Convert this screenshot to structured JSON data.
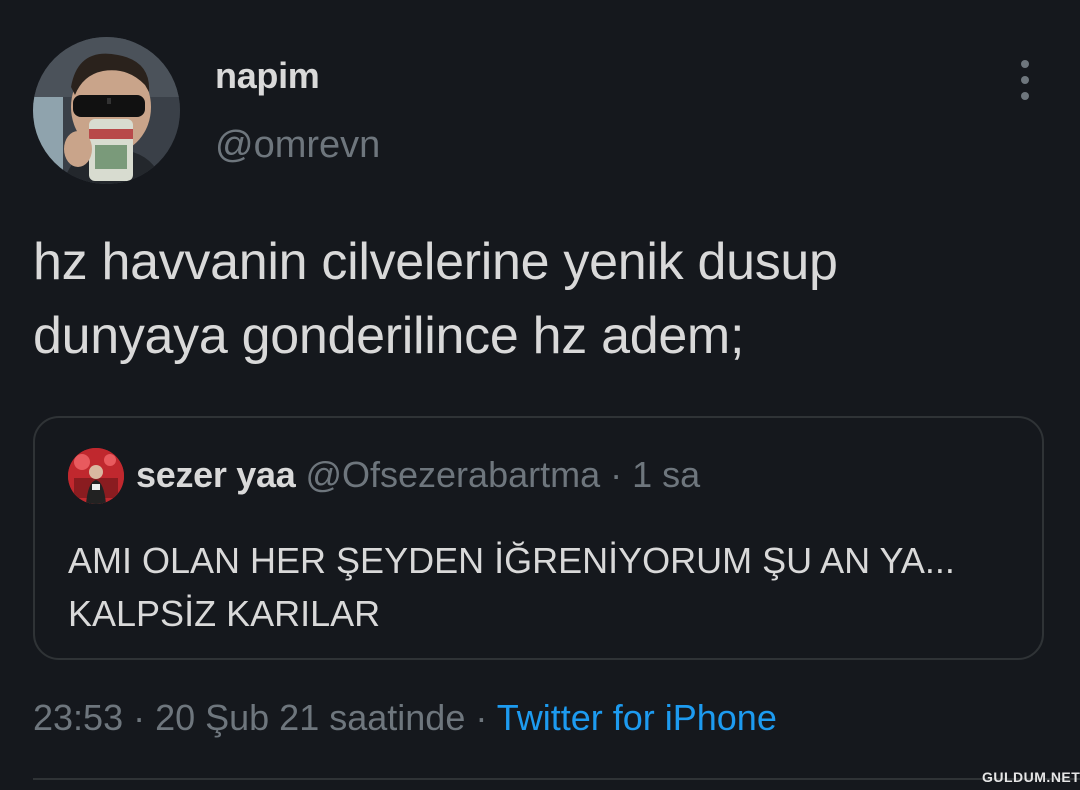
{
  "author": {
    "display_name": "napim",
    "handle": "@omrevn"
  },
  "tweet": {
    "text": "hz havvanin cilvelerine yenik dusup dunyaya gonderilince hz adem;"
  },
  "quoted": {
    "display_name": "sezer yaa",
    "handle": "@Ofsezerabartma",
    "separator": "·",
    "time": "1 sa",
    "text_line1": "AMI OLAN HER ŞEYDEN İĞRENİYORUM ŞU AN YA...",
    "text_line2": "KALPSİZ KARILAR"
  },
  "meta": {
    "timestamp": "23:53 · 20 Şub 21 saatinde",
    "separator": "·",
    "source": "Twitter for iPhone"
  },
  "watermark": "GULDUM.NET",
  "colors": {
    "background": "#15181d",
    "text": "#d9d9d9",
    "muted": "#6e767d",
    "link": "#1d9bf0",
    "border": "#2f3336"
  },
  "icons": {
    "more": "vertical-dots-icon"
  }
}
